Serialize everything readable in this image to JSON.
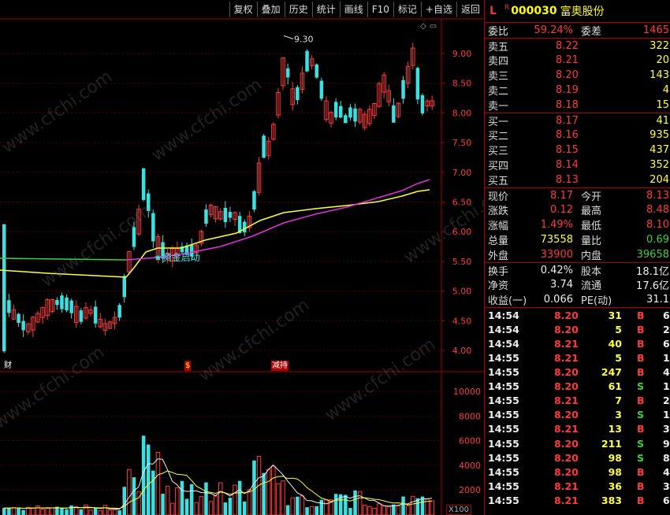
{
  "toolbar": {
    "buttons": [
      "复权",
      "叠加",
      "历史",
      "统计",
      "画线",
      "F10",
      "标记",
      "+自选",
      "返回"
    ]
  },
  "chart_data": {
    "type": "candlestick",
    "price_axis": {
      "ticks": [
        "9.00",
        "8.50",
        "8.00",
        "7.50",
        "7.00",
        "6.50",
        "6.00",
        "5.50",
        "5.00",
        "4.50",
        "4.00"
      ]
    },
    "volume_axis": {
      "ticks": [
        "10000",
        "8000",
        "6000",
        "4000",
        "2000"
      ],
      "multiplier": "X100"
    },
    "high_label": "9.30",
    "signal_label": "★资金启动",
    "event_tags": [
      "财",
      "$",
      "减持"
    ],
    "colors": {
      "up": "#ff3b3b",
      "down": "#3ce0e0",
      "ma_long": "#ffff3c",
      "ma_mid": "#e030e0",
      "ma_green": "#3cd23c"
    }
  },
  "watermark": "www.cfchi.com",
  "stock": {
    "market": "L",
    "flag": "R",
    "code": "000030",
    "name": "富奥股份"
  },
  "summary": {
    "weibi_label": "委比",
    "weibi": "59.24%",
    "weicha_label": "委差",
    "weicha": "1465"
  },
  "sell": [
    {
      "label": "卖五",
      "price": "8.22",
      "vol": "322"
    },
    {
      "label": "卖四",
      "price": "8.21",
      "vol": "20"
    },
    {
      "label": "卖三",
      "price": "8.20",
      "vol": "143"
    },
    {
      "label": "卖二",
      "price": "8.19",
      "vol": "4"
    },
    {
      "label": "卖一",
      "price": "8.18",
      "vol": "15"
    }
  ],
  "buy": [
    {
      "label": "买一",
      "price": "8.17",
      "vol": "41"
    },
    {
      "label": "买二",
      "price": "8.16",
      "vol": "935"
    },
    {
      "label": "买三",
      "price": "8.15",
      "vol": "437"
    },
    {
      "label": "买四",
      "price": "8.14",
      "vol": "352"
    },
    {
      "label": "买五",
      "price": "8.13",
      "vol": "204"
    }
  ],
  "quote": [
    {
      "l1": "现价",
      "v1": "8.17",
      "l2": "今开",
      "v2": "8.13"
    },
    {
      "l1": "涨跌",
      "v1": "0.12",
      "l2": "最高",
      "v2": "8.48"
    },
    {
      "l1": "涨幅",
      "v1": "1.49%",
      "l2": "最低",
      "v2": "8.10"
    },
    {
      "l1": "总量",
      "v1": "73558",
      "l2": "量比",
      "v2": "0.69"
    },
    {
      "l1": "外盘",
      "v1": "33900",
      "l2": "内盘",
      "v2": "39658"
    }
  ],
  "fundamentals": [
    {
      "l1": "换手",
      "v1": "0.42%",
      "l2": "股本",
      "v2": "18.1亿"
    },
    {
      "l1": "净资",
      "v1": "3.74",
      "l2": "流通",
      "v2": "17.6亿"
    },
    {
      "l1": "收益(一)",
      "v1": "0.066",
      "l2": "PE(动)",
      "v2": "31.1"
    }
  ],
  "ticks": [
    {
      "time": "14:54",
      "price": "8.20",
      "vol": "31",
      "bs": "B",
      "n": "6"
    },
    {
      "time": "14:54",
      "price": "8.20",
      "vol": "5",
      "bs": "B",
      "n": "2"
    },
    {
      "time": "14:54",
      "price": "8.21",
      "vol": "40",
      "bs": "B",
      "n": "6"
    },
    {
      "time": "14:55",
      "price": "8.21",
      "vol": "5",
      "bs": "B",
      "n": "1"
    },
    {
      "time": "14:55",
      "price": "8.20",
      "vol": "247",
      "bs": "B",
      "n": "4"
    },
    {
      "time": "14:55",
      "price": "8.20",
      "vol": "61",
      "bs": "S",
      "n": "1"
    },
    {
      "time": "14:55",
      "price": "8.21",
      "vol": "7",
      "bs": "B",
      "n": "2"
    },
    {
      "time": "14:55",
      "price": "8.20",
      "vol": "3",
      "bs": "S",
      "n": "1"
    },
    {
      "time": "14:55",
      "price": "8.21",
      "vol": "13",
      "bs": "B",
      "n": "3"
    },
    {
      "time": "14:55",
      "price": "8.20",
      "vol": "211",
      "bs": "S",
      "n": "9"
    },
    {
      "time": "14:55",
      "price": "8.20",
      "vol": "98",
      "bs": "S",
      "n": "8"
    },
    {
      "time": "14:55",
      "price": "8.20",
      "vol": "98",
      "bs": "B",
      "n": "4"
    },
    {
      "time": "14:55",
      "price": "8.21",
      "vol": "36",
      "bs": "B",
      "n": "3"
    },
    {
      "time": "14:55",
      "price": "8.21",
      "vol": "383",
      "bs": "B",
      "n": "6"
    }
  ]
}
